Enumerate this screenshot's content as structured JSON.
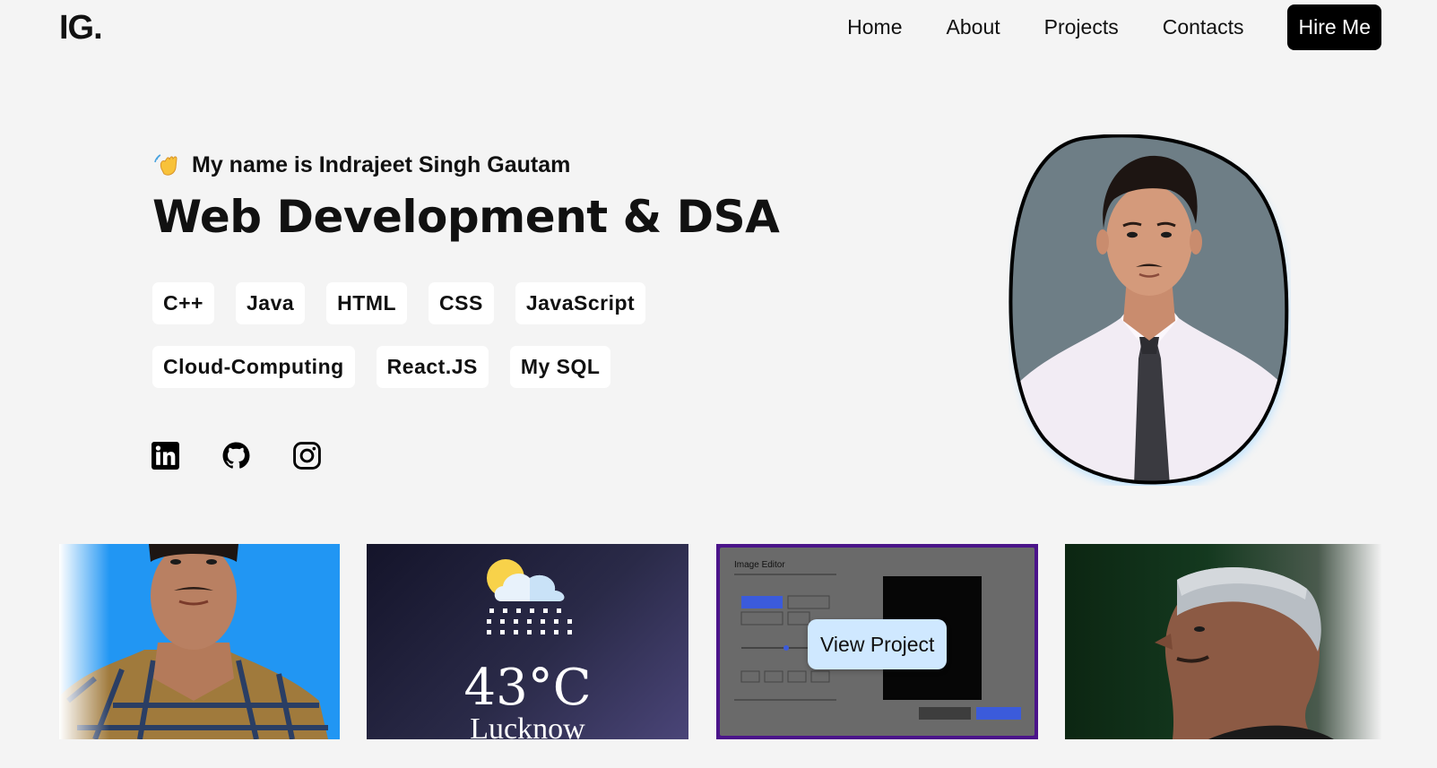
{
  "brand": {
    "logo": "IG."
  },
  "nav": {
    "links": [
      "Home",
      "About",
      "Projects",
      "Contacts"
    ],
    "cta": "Hire Me"
  },
  "hero": {
    "greeting": "My name is Indrajeet Singh Gautam",
    "headline": "Web Development & DSA",
    "skills": [
      "C++",
      "Java",
      "HTML",
      "CSS",
      "JavaScript",
      "Cloud-Computing",
      "React.JS",
      "My SQL"
    ]
  },
  "socials": [
    "linkedin-icon",
    "github-icon",
    "instagram-icon"
  ],
  "projects": {
    "weather": {
      "temperature": "43°C",
      "city": "Lucknow"
    },
    "image_editor": {
      "title": "Image Editor",
      "cta": "View Project"
    }
  },
  "colors": {
    "background": "#f4f4f4",
    "button": "#000000",
    "chip": "#ffffff",
    "view_button": "#cfe8ff",
    "card1": "#2196f3",
    "card3_border": "#4b148a"
  }
}
